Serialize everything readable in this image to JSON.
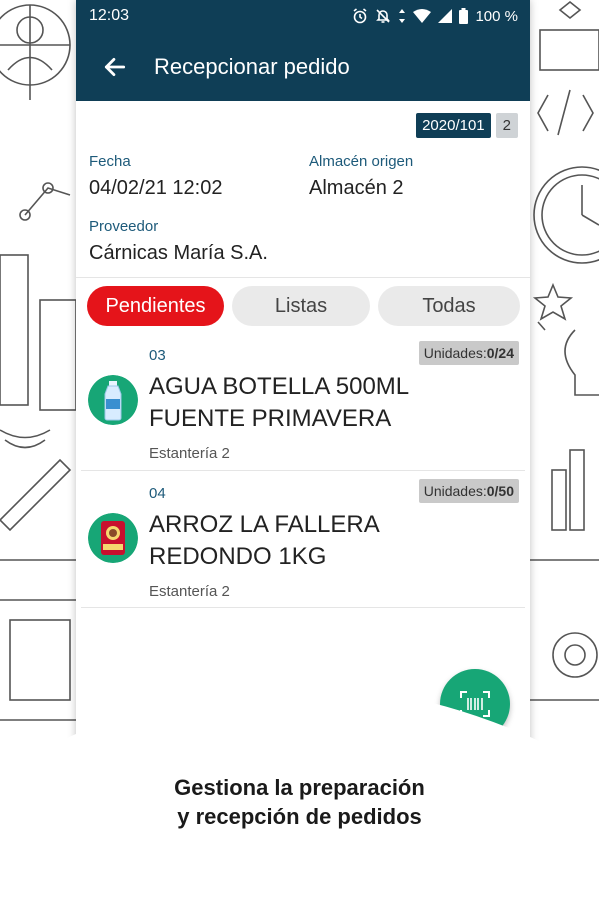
{
  "status_bar": {
    "time": "12:03",
    "battery": "100 %",
    "icons": [
      "alarm-icon",
      "bell-off-icon",
      "data-arrows-icon",
      "wifi-icon",
      "signal-icon",
      "battery-icon"
    ]
  },
  "app_bar": {
    "title": "Recepcionar pedido",
    "back_icon": "arrow-left-icon"
  },
  "order": {
    "number": "2020/101",
    "count": "2",
    "date_label": "Fecha",
    "date_value": "04/02/21 12:02",
    "warehouse_label": "Almacén origen",
    "warehouse_value": "Almacén 2",
    "supplier_label": "Proveedor",
    "supplier_value": "Cárnicas María S.A."
  },
  "tabs": [
    {
      "label": "Pendientes",
      "active": true
    },
    {
      "label": "Listas",
      "active": false
    },
    {
      "label": "Todas",
      "active": false
    }
  ],
  "items": [
    {
      "code": "03",
      "units_label": "Unidades:",
      "units_value": "0/24",
      "name_line1": "AGUA BOTELLA 500ML",
      "name_line2": "FUENTE PRIMAVERA",
      "location": "Estantería 2",
      "icon": "water-bottle-icon"
    },
    {
      "code": "04",
      "units_label": "Unidades:",
      "units_value": "0/50",
      "name_line1": "ARROZ LA FALLERA",
      "name_line2": "REDONDO 1KG",
      "location": "Estantería 2",
      "icon": "rice-package-icon"
    }
  ],
  "fab": {
    "icon": "barcode-scan-icon"
  },
  "caption": {
    "line1": "Gestiona la preparación",
    "line2": "y recepción de pedidos"
  },
  "colors": {
    "primary": "#0f3e56",
    "accent_red": "#e5141a",
    "fab_green": "#17a676"
  }
}
